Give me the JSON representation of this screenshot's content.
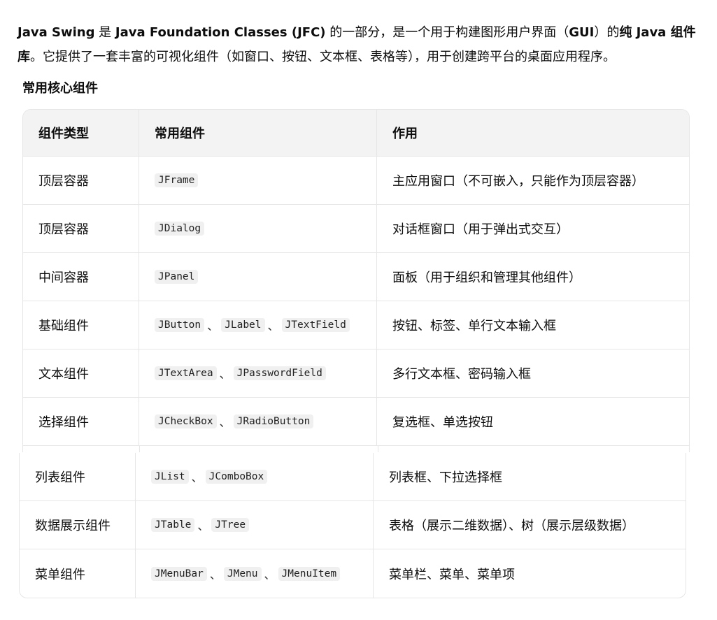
{
  "intro": {
    "p1": "Java Swing",
    "p2": " 是 ",
    "p3": "Java Foundation Classes (JFC)",
    "p4": " 的一部分，是一个用于构建图形用户界面（",
    "p5": "GUI",
    "p6": "）的",
    "p7": "纯 Java 组件库",
    "p8": "。它提供了一套丰富的可视化组件（如窗口、按钮、文本框、表格等），用于创建跨平台的桌面应用程序。"
  },
  "section_title": "常用核心组件",
  "table": {
    "headers": [
      "组件类型",
      "常用组件",
      "作用"
    ],
    "rows": [
      {
        "type": "顶层容器",
        "components": [
          "JFrame"
        ],
        "purpose": "主应用窗口（不可嵌入，只能作为顶层容器）"
      },
      {
        "type": "顶层容器",
        "components": [
          "JDialog"
        ],
        "purpose": "对话框窗口（用于弹出式交互）"
      },
      {
        "type": "中间容器",
        "components": [
          "JPanel"
        ],
        "purpose": "面板（用于组织和管理其他组件）"
      },
      {
        "type": "基础组件",
        "components": [
          "JButton",
          "JLabel",
          "JTextField"
        ],
        "purpose": "按钮、标签、单行文本输入框"
      },
      {
        "type": "文本组件",
        "components": [
          "JTextArea",
          "JPasswordField"
        ],
        "purpose": "多行文本框、密码输入框"
      },
      {
        "type": "选择组件",
        "components": [
          "JCheckBox",
          "JRadioButton"
        ],
        "purpose": "复选框、单选按钮"
      },
      {
        "type": "列表组件",
        "components": [
          "JList",
          "JComboBox"
        ],
        "purpose": "列表框、下拉选择框"
      },
      {
        "type": "数据展示组件",
        "components": [
          "JTable",
          "JTree"
        ],
        "purpose": "表格（展示二维数据）、树（展示层级数据）"
      },
      {
        "type": "菜单组件",
        "components": [
          "JMenuBar",
          "JMenu",
          "JMenuItem"
        ],
        "purpose": "菜单栏、菜单、菜单项"
      }
    ],
    "separator": "、"
  }
}
